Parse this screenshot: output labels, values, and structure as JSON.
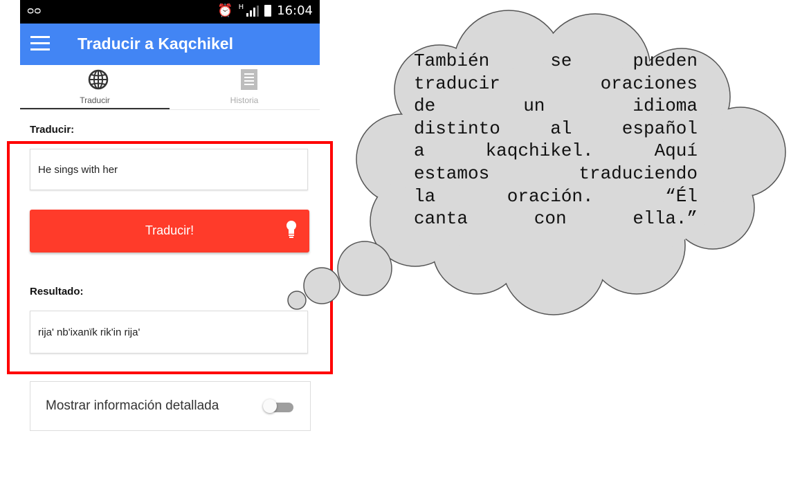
{
  "status_bar": {
    "time": "16:04",
    "network_type": "H",
    "icons": [
      "voicemail-icon",
      "alarm-icon",
      "signal-icon",
      "battery-icon"
    ]
  },
  "app_bar": {
    "title": "Traducir a Kaqchikel",
    "color": "#4285f4"
  },
  "tabs": [
    {
      "label": "Traducir",
      "icon": "globe-icon",
      "active": true
    },
    {
      "label": "Historia",
      "icon": "document-icon",
      "active": false
    }
  ],
  "translate": {
    "label": "Traducir:",
    "input_value": "He sings with her",
    "button_label": "Traducir!",
    "button_color": "#ff3b2a"
  },
  "result": {
    "label": "Resultado:",
    "value": "rija' nb'ixanïk rik'in rija'"
  },
  "details": {
    "label": "Mostrar información detallada",
    "toggle_on": false
  },
  "annotation": {
    "lines": [
      "También se pueden",
      "traducir oraciones",
      "de un idioma",
      "distinto al español",
      "a kaqchikel. Aquí",
      "estamos traduciendo",
      "la oración. “Él",
      "canta con ella.”"
    ],
    "highlight_color": "#ff0000",
    "cloud_fill": "#d9d9d9"
  }
}
